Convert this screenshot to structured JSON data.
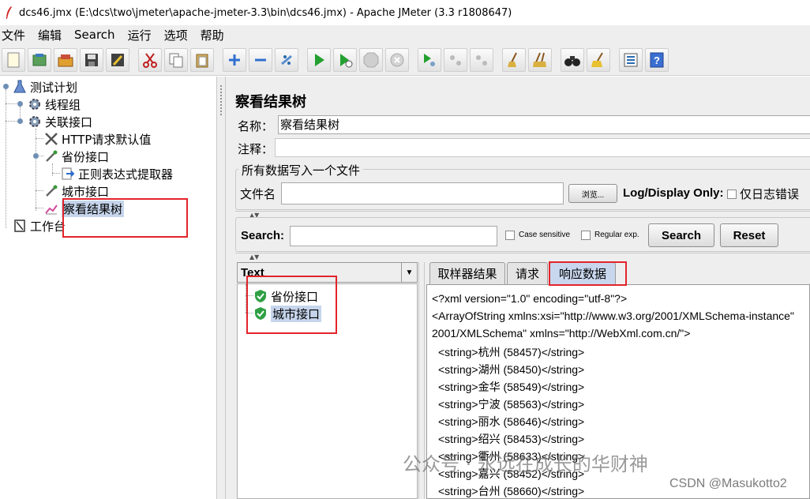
{
  "window": {
    "title": "dcs46.jmx (E:\\dcs\\two\\jmeter\\apache-jmeter-3.3\\bin\\dcs46.jmx) - Apache JMeter (3.3 r1808647)"
  },
  "menu": [
    "文件",
    "编辑",
    "Search",
    "运行",
    "选项",
    "帮助"
  ],
  "toolbar": {
    "icons": [
      "new-icon",
      "templates-icon",
      "open-icon",
      "save-icon",
      "save-as-icon",
      "cut-icon",
      "copy-icon",
      "paste-icon",
      "expand-icon",
      "collapse-icon",
      "toggle-icon",
      "start-icon",
      "start-no-pause-icon",
      "stop-icon",
      "shutdown-icon",
      "remote-start-icon",
      "remote-stop-icon",
      "remote-shutdown-icon",
      "clear-icon",
      "clear-all-icon",
      "search-icon",
      "reset-search-icon",
      "function-helper-icon",
      "help-icon"
    ]
  },
  "tree": {
    "nodes": [
      {
        "label": "测试计划",
        "icon": "test-plan-icon"
      },
      {
        "label": "线程组",
        "icon": "gear-icon"
      },
      {
        "label": "关联接口",
        "icon": "gear-icon"
      },
      {
        "label": "HTTP请求默认值",
        "icon": "wrench-icon"
      },
      {
        "label": "省份接口",
        "icon": "pipette-icon"
      },
      {
        "label": "正则表达式提取器",
        "icon": "extractor-icon"
      },
      {
        "label": "城市接口",
        "icon": "pipette-icon"
      },
      {
        "label": "察看结果树",
        "icon": "chart-icon"
      },
      {
        "label": "工作台",
        "icon": "workbench-icon"
      }
    ]
  },
  "panel": {
    "title": "察看结果树",
    "name_label": "名称：",
    "name_value": "察看结果树",
    "comment_label": "注释：",
    "comment_value": "",
    "file_section": "所有数据写入一个文件",
    "filename_label": "文件名",
    "browse_label": "浏览...",
    "log_display_label": "Log/Display Only:",
    "errors_only_label": "仅日志错误",
    "search_label": "Search:",
    "case_sensitive_label": "Case sensitive",
    "regex_label": "Regular exp.",
    "search_button": "Search",
    "reset_button": "Reset"
  },
  "results": {
    "renderer": "Text",
    "samples": [
      "省份接口",
      "城市接口"
    ]
  },
  "tabs": [
    "取样器结果",
    "请求",
    "响应数据"
  ],
  "response_lines": [
    "<?xml version=\"1.0\" encoding=\"utf-8\"?>",
    "<ArrayOfString xmlns:xsi=\"http://www.w3.org/2001/XMLSchema-instance\"",
    "2001/XMLSchema\" xmlns=\"http://WebXml.com.cn/\">",
    "  <string>杭州 (58457)</string>",
    "  <string>湖州 (58450)</string>",
    "  <string>金华 (58549)</string>",
    "  <string>宁波 (58563)</string>",
    "  <string>丽水 (58646)</string>",
    "  <string>绍兴 (58453)</string>",
    "  <string>衢州 (58633)</string>",
    "  <string>嘉兴 (58452)</string>",
    "  <string>台州 (58660)</string>"
  ],
  "watermark": {
    "line1": "公众号 · 永远在成长的华财神",
    "line2": "CSDN @Masukotto2"
  },
  "colors": {
    "selection": "#c6d5ec",
    "active_tab": "#c8d7ee",
    "highlight_box": "#e3242b",
    "success_icon": "#2ea043"
  }
}
